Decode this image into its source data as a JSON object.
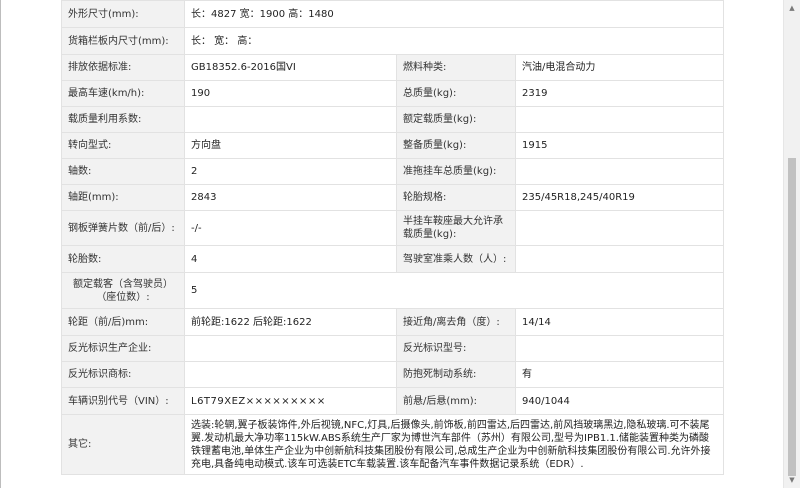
{
  "rows": [
    {
      "label": "外形尺寸(mm):",
      "value": "长：4827 宽：1900 高：1480"
    },
    {
      "label": "货箱栏板内尺寸(mm):",
      "value": "长：  宽：  高："
    },
    {
      "label": "排放依据标准:",
      "value": "GB18352.6-2016国VI",
      "label2": "燃料种类:",
      "value2": "汽油/电混合动力"
    },
    {
      "label": "最高车速(km/h):",
      "value": "190",
      "label2": "总质量(kg):",
      "value2": "2319"
    },
    {
      "label": "载质量利用系数:",
      "value": "",
      "label2": "额定载质量(kg):",
      "value2": ""
    },
    {
      "label": "转向型式:",
      "value": "方向盘",
      "label2": "整备质量(kg):",
      "value2": "1915"
    },
    {
      "label": "轴数:",
      "value": "2",
      "label2": "准拖挂车总质量(kg):",
      "value2": ""
    },
    {
      "label": "轴距(mm):",
      "value": "2843",
      "label2": "轮胎规格:",
      "value2": "235/45R18,245/40R19"
    },
    {
      "label": "钢板弹簧片数（前/后）:",
      "value": "-/-",
      "label2": "半挂车鞍座最大允许承载质量(kg):",
      "value2": ""
    },
    {
      "label": "轮胎数:",
      "value": "4",
      "label2": "驾驶室准乘人数（人）:",
      "value2": ""
    },
    {
      "label": "额定载客（含驾驶员）（座位数）:",
      "value": "5"
    },
    {
      "label": "轮距（前/后)mm:",
      "value": "前轮距:1622 后轮距:1622",
      "label2": "接近角/离去角（度）:",
      "value2": "14/14"
    },
    {
      "label": "反光标识生产企业:",
      "value": "",
      "label2": "反光标识型号:",
      "value2": ""
    },
    {
      "label": "反光标识商标:",
      "value": "",
      "label2": "防抱死制动系统:",
      "value2": "有"
    },
    {
      "label": "车辆识别代号（VIN）:",
      "value": "L6T79XEZ×××××××××",
      "label2": "前悬/后悬(mm):",
      "value2": "940/1044"
    },
    {
      "label": "其它:",
      "value": "选装:轮辋,翼子板装饰件,外后视镜,NFC,灯具,后摄像头,前饰板,前四雷达,后四雷达,前风挡玻璃黑边,隐私玻璃.可不装尾翼.发动机最大净功率115kW.ABS系统生产厂家为博世汽车部件（苏州）有限公司,型号为IPB1.1.储能装置种类为磷酸铁锂蓄电池,单体生产企业为中创新航科技集团股份有限公司,总成生产企业为中创新航科技集团股份有限公司.允许外接充电,具备纯电动模式.该车可选装ETC车载装置.该车配备汽车事件数据记录系统（EDR）."
    }
  ]
}
